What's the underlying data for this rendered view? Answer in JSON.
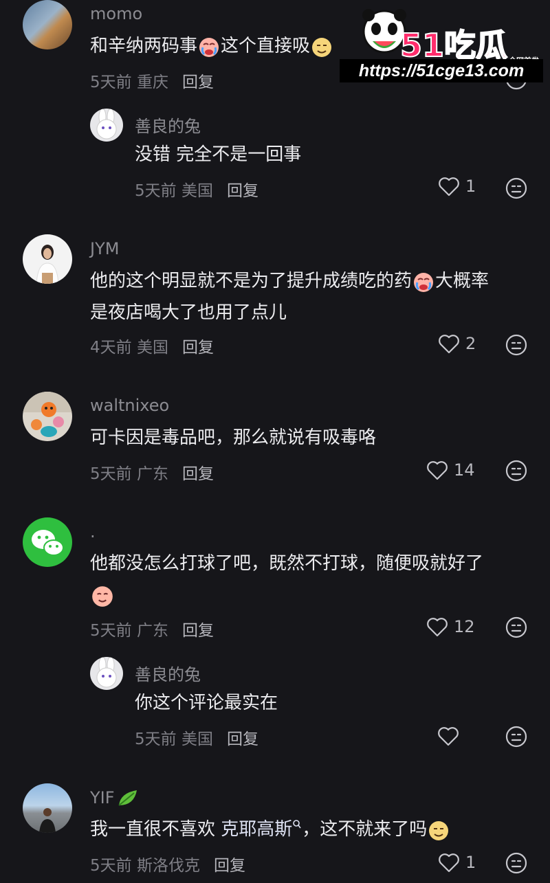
{
  "comments": [
    {
      "user": "momo",
      "text_lines": [
        "和辛纳两码事",
        "这个直接吸"
      ],
      "time": "5天前",
      "region": "重庆",
      "reply": "回复",
      "likes": "",
      "avatar": "avatar-landscape"
    },
    {
      "user": "善良的兔",
      "text_lines": [
        "没错 完全不是一回事"
      ],
      "time": "5天前",
      "region": "美国",
      "reply": "回复",
      "likes": "1",
      "avatar": "avatar-rabbit"
    },
    {
      "user": "JYM",
      "text_lines": [
        "他的这个明显就不是为了提升成绩吃的药",
        "大概率",
        "是夜店喝大了也用了点儿"
      ],
      "time": "4天前",
      "region": "美国",
      "reply": "回复",
      "likes": "2",
      "avatar": "avatar-woman"
    },
    {
      "user": "waltnixeo",
      "text_lines": [
        "可卡因是毒品吧，那么就说有吸毒咯"
      ],
      "time": "5天前",
      "region": "广东",
      "reply": "回复",
      "likes": "14",
      "avatar": "avatar-toys"
    },
    {
      "user": ".",
      "text_lines": [
        "他都没怎么打球了吧，既然不打球，随便吸就好了"
      ],
      "time": "5天前",
      "region": "广东",
      "reply": "回复",
      "likes": "12",
      "avatar": "avatar-wechat"
    },
    {
      "user": "善良的兔",
      "text_lines": [
        "你这个评论最实在"
      ],
      "time": "5天前",
      "region": "美国",
      "reply": "回复",
      "likes": "",
      "avatar": "avatar-rabbit"
    },
    {
      "user": "YIF",
      "text_lines": [
        "我一直很不喜欢 ",
        "克耶高斯",
        "，这不就来了吗"
      ],
      "time": "5天前",
      "region": "斯洛伐克",
      "reply": "回复",
      "likes": "1",
      "avatar": "avatar-beach"
    }
  ],
  "watermark": {
    "logo": "51吃瓜",
    "badge": "全网首发",
    "url": "https://51cge13.com"
  }
}
